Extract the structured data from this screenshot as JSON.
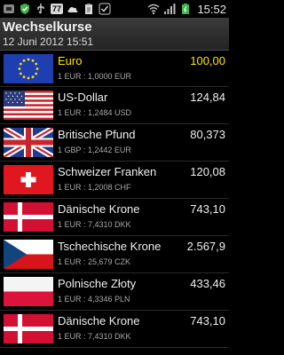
{
  "status_bar": {
    "time": "15:52",
    "notification_count": "77"
  },
  "header": {
    "title": "Wechselkurse",
    "subtitle": "12 Juni 2012 15:51"
  },
  "rows": [
    {
      "flag": "eu-flag-icon",
      "name": "Euro",
      "value": "100,00",
      "rate": "1 EUR : 1,0000 EUR",
      "base": true
    },
    {
      "flag": "us-flag-icon",
      "name": "US-Dollar",
      "value": "124,84",
      "rate": "1 EUR : 1,2484 USD"
    },
    {
      "flag": "uk-flag-icon",
      "name": "Britische Pfund",
      "value": "80,373",
      "rate": "1 GBP : 1,2442 EUR"
    },
    {
      "flag": "swiss-flag-icon",
      "name": "Schweizer Franken",
      "value": "120,08",
      "rate": "1 EUR : 1,2008 CHF"
    },
    {
      "flag": "danish-flag-icon",
      "name": "Dänische Krone",
      "value": "743,10",
      "rate": "1 EUR : 7,4310 DKK"
    },
    {
      "flag": "czech-flag-icon",
      "name": "Tschechische Krone",
      "value": "2.567,9",
      "rate": "1 EUR : 25,679 CZK"
    },
    {
      "flag": "polish-flag-icon",
      "name": "Polnische Złoty",
      "value": "433,46",
      "rate": "1 EUR : 4,3346 PLN"
    },
    {
      "flag": "danish-flag-icon",
      "name": "Dänische Krone",
      "value": "743,10",
      "rate": "1 EUR : 7,4310 DKK"
    }
  ],
  "colors": {
    "base_highlight": "#ffe600",
    "header_bg": "#2f2f2f"
  }
}
